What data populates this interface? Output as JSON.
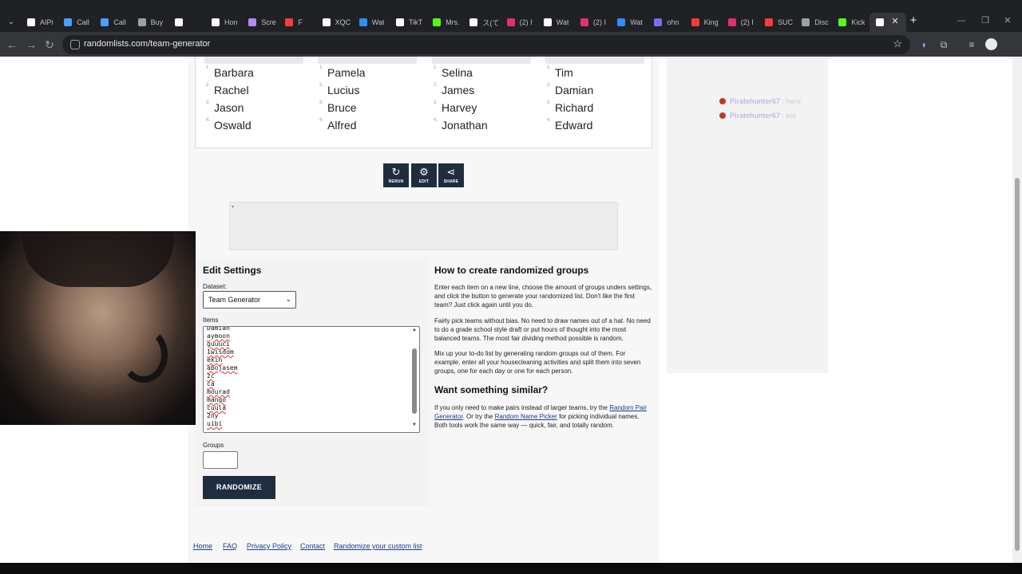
{
  "browser": {
    "tabs": [
      {
        "label": "AIPi",
        "color": "#ffffff"
      },
      {
        "label": "Call",
        "color": "#4a9eff"
      },
      {
        "label": "Call",
        "color": "#4a9eff"
      },
      {
        "label": "Buy",
        "color": "#9aa0a6"
      },
      {
        "label": "",
        "color": "#ffffff"
      },
      {
        "label": "Hon",
        "color": "#ffffff"
      },
      {
        "label": "Scre",
        "color": "#b48cf0"
      },
      {
        "label": "F",
        "color": "#ff3b3b"
      },
      {
        "label": "XQC",
        "color": "#ffffff"
      },
      {
        "label": "Wat",
        "color": "#2d8cff"
      },
      {
        "label": "TikT",
        "color": "#ffffff"
      },
      {
        "label": "Mrs.",
        "color": "#53fc18"
      },
      {
        "label": "ス(て",
        "color": "#ffffff"
      },
      {
        "label": "(2) I",
        "color": "#e1306c"
      },
      {
        "label": "Wat",
        "color": "#ffffff"
      },
      {
        "label": "(2) I",
        "color": "#e1306c"
      },
      {
        "label": "Wat",
        "color": "#2d8cff"
      },
      {
        "label": "ohn",
        "color": "#7b6cf6"
      },
      {
        "label": "King",
        "color": "#ff3b3b"
      },
      {
        "label": "(2) I",
        "color": "#e1306c"
      },
      {
        "label": "SUC",
        "color": "#ff3b3b"
      },
      {
        "label": "Disc",
        "color": "#9aa0a6"
      },
      {
        "label": "Kick",
        "color": "#53fc18"
      },
      {
        "label": "",
        "color": "#ffffff"
      }
    ],
    "url": "randomlists.com/team-generator"
  },
  "groups": [
    {
      "members": [
        "Barbara",
        "Rachel",
        "Jason",
        "Oswald"
      ]
    },
    {
      "members": [
        "Pamela",
        "Lucius",
        "Bruce",
        "Alfred"
      ]
    },
    {
      "members": [
        "Selina",
        "James",
        "Harvey",
        "Jonathan"
      ]
    },
    {
      "members": [
        "Tim",
        "Damian",
        "Richard",
        "Edward"
      ]
    }
  ],
  "actions": {
    "rerun": "RERUN",
    "edit": "EDIT",
    "share": "SHARE"
  },
  "settings": {
    "title": "Edit Settings",
    "dataset_label": "Dataset:",
    "dataset_value": "Team Generator",
    "items_label": "Items",
    "items_lines": [
      "Damian",
      "aymoon",
      "guuuci",
      "1wisdom",
      "ekin",
      "abojasem",
      "zc",
      "ca",
      "mourad",
      "mango",
      "cuula",
      "2ny",
      "uibi"
    ],
    "groups_label": "Groups",
    "groups_value": "",
    "randomize_label": "RANDOMIZE"
  },
  "howto": {
    "title": "How to create randomized groups",
    "p1": "Enter each item on a new line, choose the amount of groups unders settings, and click the button to generate your randomized list. Don't like the first team? Just click again until you do.",
    "p2": "Fairly pick teams without bias. No need to draw names out of a hat. No need to do a grade school style draft or put hours of thought into the most balanced teams. The most fair dividing method possible is random.",
    "p3": "Mix up your to-do list by generating random groups out of them. For example, enter all your housecleaning activities and split them into seven groups, one for each day or one for each person.",
    "similar_title": "Want something similar?",
    "p4_a": "If you only need to make pairs instead of larger teams, try the ",
    "p4_link1": "Random Pair Generator",
    "p4_b": ". Or try the ",
    "p4_link2": "Random Name Picker",
    "p4_c": " for picking individual names. Both tools work the same way — quick, fair, and totally random."
  },
  "chat": [
    {
      "user": "Piratehunter67",
      "sep": ":",
      "msg": "here"
    },
    {
      "user": "Piratehunter67",
      "sep": ":",
      "msg": "me"
    }
  ],
  "footer": {
    "links": [
      "Home",
      "FAQ",
      "Privacy Policy",
      "Contact",
      "Randomize your custom list"
    ]
  },
  "icons": {
    "rerun": "rerun-icon",
    "edit": "gear-icon",
    "share": "share-icon",
    "star": "star-icon"
  }
}
